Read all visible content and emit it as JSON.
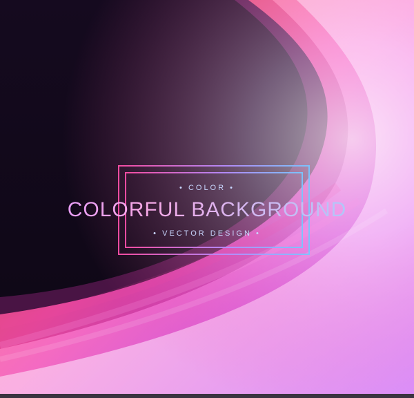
{
  "badge": {
    "kicker": "• COLOR •",
    "title": "COLORFUL BACKGROUND",
    "subtitle": "• VECTOR DESIGN •"
  },
  "colors": {
    "background": "#1a0a24",
    "wave_warm": "#ff8a3d",
    "wave_pink": "#ff4fa8",
    "wave_magenta": "#c83cff",
    "wave_white": "#fff5fb",
    "frame_left": "#ff4fa8",
    "frame_right": "#79c6ff"
  }
}
